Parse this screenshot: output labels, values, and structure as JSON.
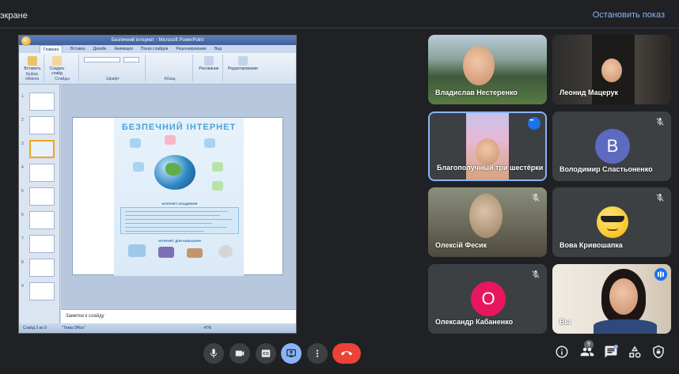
{
  "header": {
    "present_text": "экране",
    "stop_button": "Остановить показ"
  },
  "ppt": {
    "window_title": "Безпечний інтернет - Microsoft PowerPoint",
    "tabs": [
      "Главная",
      "Вставка",
      "Дизайн",
      "Анимация",
      "Показ слайдов",
      "Рецензирование",
      "Вид"
    ],
    "ribbon": {
      "paste": "Вставить",
      "new_slide": "Создать слайд",
      "clipboard_group": "Буфер обмена",
      "slides_group": "Слайды",
      "font_group": "Шрифт",
      "paragraph_group": "Абзац",
      "drawing": "Рисование",
      "editing": "Редактирование"
    },
    "thumbnail_numbers": [
      "1",
      "2",
      "3",
      "4",
      "5",
      "6",
      "7",
      "8",
      "9"
    ],
    "slide": {
      "title": "БЕЗПЕЧНИЙ ІНТЕРНЕТ",
      "section1": "ІНТЕРНЕТ-ЗЛОДІЯННЯ",
      "section2": "ІНТЕРНЕТ ДЛЯ НАВЧАННЯ"
    },
    "notes_placeholder": "Заметки к слайду",
    "status": {
      "slide": "Слайд 3 из 9",
      "theme": "\"Тема Office\"",
      "zoom": "47%"
    }
  },
  "participants": [
    {
      "name": "Владислав Нестеренко",
      "type": "video"
    },
    {
      "name": "Леонид Мацерук",
      "type": "video"
    },
    {
      "name": "Благополучный три шестёрки",
      "type": "video",
      "pinned_menu": true
    },
    {
      "name": "Володимир Сластьоненко",
      "type": "avatar",
      "initial": "В",
      "color": "#5c6bc0",
      "muted": true
    },
    {
      "name": "Олексій Фесик",
      "type": "video",
      "muted": true
    },
    {
      "name": "Вова Кривошапка",
      "type": "emoji",
      "muted": true
    },
    {
      "name": "Олександр Кабаненко",
      "type": "avatar",
      "initial": "О",
      "color": "#e8175d",
      "muted": true
    },
    {
      "name": "Вы",
      "type": "video",
      "speaking": true
    }
  ],
  "controls": {
    "participants_count": "9"
  },
  "colors": {
    "accent": "#8ab4f8",
    "end_call": "#ea4335",
    "background": "#202124"
  }
}
